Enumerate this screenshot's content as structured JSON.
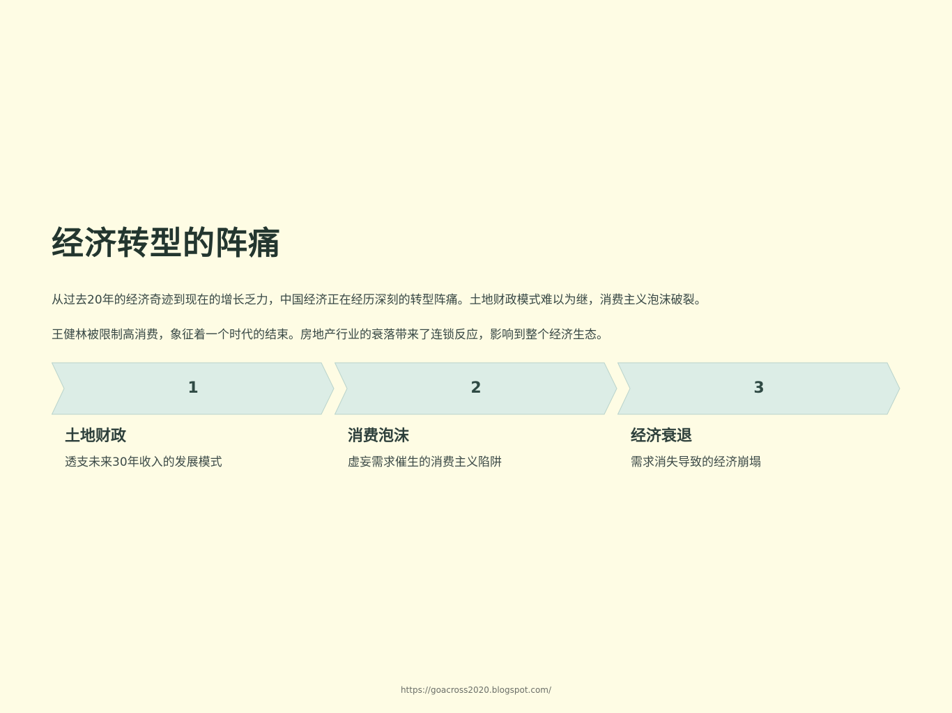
{
  "slide": {
    "title": "经济转型的阵痛",
    "paragraphs": [
      "从过去20年的经济奇迹到现在的增长乏力，中国经济正在经历深刻的转型阵痛。土地财政模式难以为继，消费主义泡沫破裂。",
      "王健林被限制高消费，象征着一个时代的结束。房地产行业的衰落带来了连锁反应，影响到整个经济生态。"
    ],
    "steps": [
      {
        "number": "1",
        "title": "土地财政",
        "description": "透支未来30年收入的发展模式"
      },
      {
        "number": "2",
        "title": "消费泡沫",
        "description": "虚妄需求催生的消费主义陷阱"
      },
      {
        "number": "3",
        "title": "经济衰退",
        "description": "需求消失导致的经济崩塌"
      }
    ],
    "colors": {
      "background": "#fefce4",
      "chevron_fill": "#dcede6",
      "chevron_stroke": "#b9d3cb",
      "title": "#23362f"
    }
  },
  "footer": {
    "url": "https://goacross2020.blogspot.com/"
  }
}
